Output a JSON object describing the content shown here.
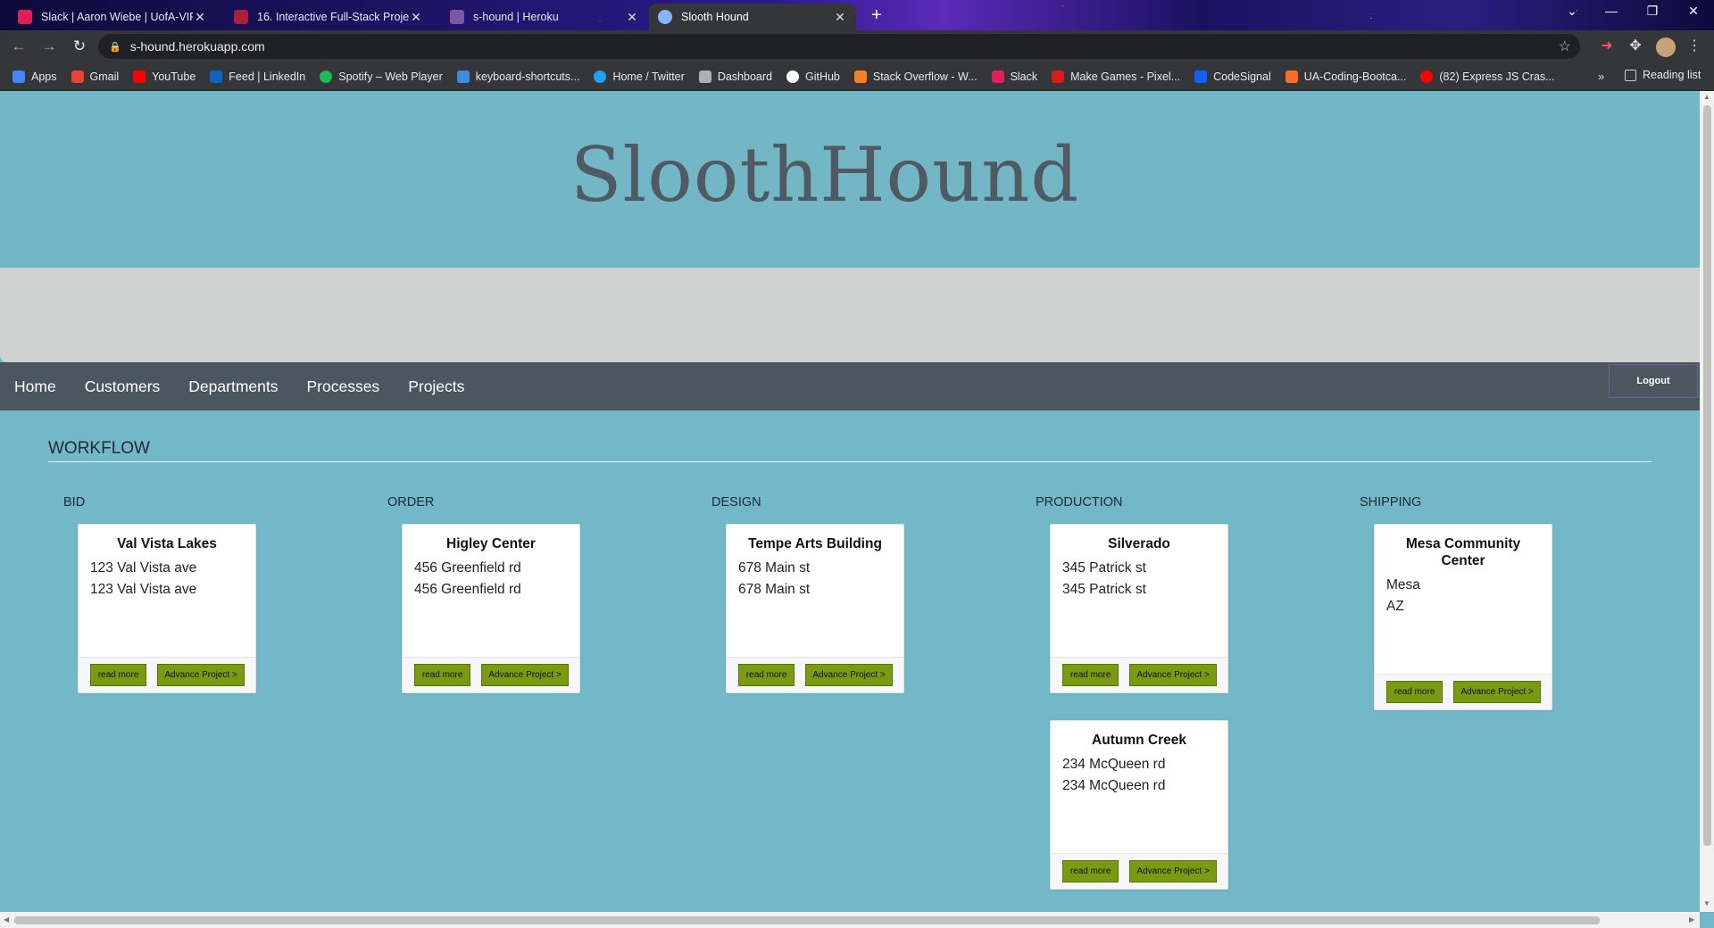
{
  "browser": {
    "tabs": [
      {
        "title": "Slack | Aaron Wiebe | UofA-VIRT",
        "color": "#e01e5a"
      },
      {
        "title": "16. Interactive Full-Stack Project",
        "color": "#ab1e3c"
      },
      {
        "title": "s-hound | Heroku",
        "color": "#79589f"
      },
      {
        "title": "Slooth Hound",
        "color": "#8ab4f8"
      }
    ],
    "url": "s-hound.herokuapp.com",
    "bookmarks": [
      {
        "label": "Apps",
        "color": "#4285f4"
      },
      {
        "label": "Gmail",
        "color": "#ea4335"
      },
      {
        "label": "YouTube",
        "color": "#ff0000"
      },
      {
        "label": "Feed | LinkedIn",
        "color": "#0a66c2"
      },
      {
        "label": "Spotify – Web Player",
        "color": "#1db954"
      },
      {
        "label": "keyboard-shortcuts...",
        "color": "#3c8dde"
      },
      {
        "label": "Home / Twitter",
        "color": "#1da1f2"
      },
      {
        "label": "Dashboard",
        "color": "#b0b0b0"
      },
      {
        "label": "GitHub",
        "color": "#ffffff"
      },
      {
        "label": "Stack Overflow - W...",
        "color": "#f48024"
      },
      {
        "label": "Slack",
        "color": "#e01e5a"
      },
      {
        "label": "Make Games - Pixel...",
        "color": "#d81b1b"
      },
      {
        "label": "CodeSignal",
        "color": "#1062fb"
      },
      {
        "label": "UA-Coding-Bootca...",
        "color": "#fc6d26"
      },
      {
        "label": "(82) Express JS Cras...",
        "color": "#ff0000"
      }
    ],
    "reading_list": "Reading list"
  },
  "site": {
    "brand": "SloothHound",
    "nav": [
      "Home",
      "Customers",
      "Departments",
      "Processes",
      "Projects"
    ],
    "logout": "Logout",
    "section_title": "WORKFLOW"
  },
  "columns": [
    {
      "title": "BID",
      "cards": [
        {
          "title": "Val Vista Lakes",
          "lines": [
            "123 Val Vista ave",
            "123 Val Vista ave"
          ],
          "read_more": "read more",
          "advance": "Advance Project >"
        }
      ]
    },
    {
      "title": "ORDER",
      "cards": [
        {
          "title": "Higley Center",
          "lines": [
            "456 Greenfield rd",
            "456 Greenfield rd"
          ],
          "read_more": "read more",
          "advance": "Advance Project >"
        }
      ]
    },
    {
      "title": "DESIGN",
      "cards": [
        {
          "title": "Tempe Arts Building",
          "lines": [
            "678 Main st",
            "678 Main st"
          ],
          "read_more": "read more",
          "advance": "Advance Project >"
        }
      ]
    },
    {
      "title": "PRODUCTION",
      "cards": [
        {
          "title": "Silverado",
          "lines": [
            "345 Patrick st",
            "345 Patrick st"
          ],
          "read_more": "read more",
          "advance": "Advance Project >"
        },
        {
          "title": "Autumn Creek",
          "lines": [
            "234 McQueen rd",
            "234 McQueen rd"
          ],
          "read_more": "read more",
          "advance": "Advance Project >"
        }
      ]
    },
    {
      "title": "SHIPPING",
      "cards": [
        {
          "title": "Mesa Community Center",
          "lines": [
            "Mesa",
            "AZ"
          ],
          "read_more": "read more",
          "advance": "Advance Project >"
        }
      ]
    }
  ]
}
